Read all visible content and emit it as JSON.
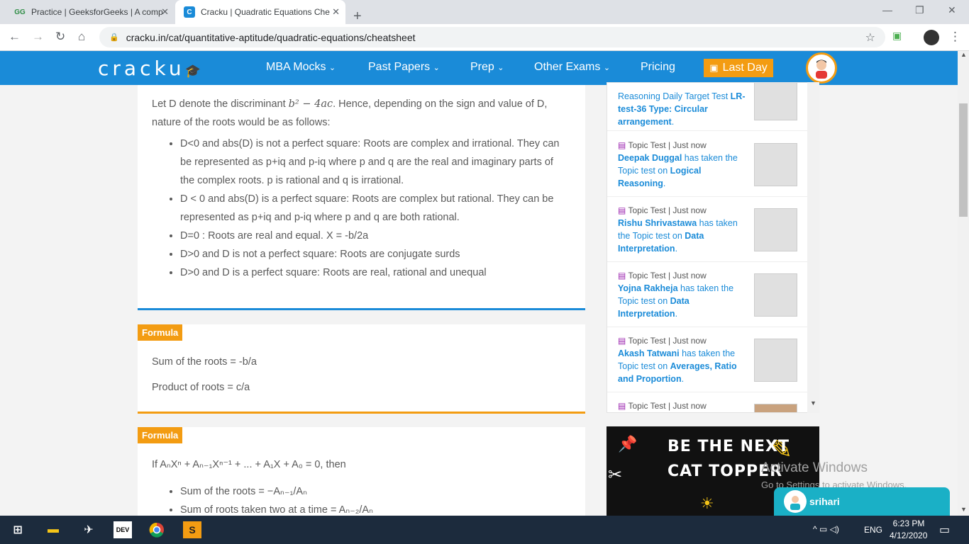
{
  "browser": {
    "tabs": [
      {
        "title": "Practice | GeeksforGeeks | A comp",
        "favicon": "GG"
      },
      {
        "title": "Cracku | Quadratic Equations Che",
        "favicon": "C"
      }
    ],
    "url": "cracku.in/cat/quantitative-aptitude/quadratic-equations/cheatsheet"
  },
  "site": {
    "logo": "cracku",
    "nav": [
      "MBA Mocks",
      "Past Papers",
      "Prep",
      "Other Exams",
      "Pricing"
    ],
    "last_day": "Last Day"
  },
  "content": {
    "intro_pre": "Let D denote the discriminant ",
    "intro_math": "b² − 4ac",
    "intro_post": ". Hence, depending on the sign and value of D, nature of the roots would be as follows:",
    "bullets": [
      "D<0 and abs(D) is not a perfect square: Roots are complex and irrational. They can be represented as p+iq and p-iq where p and q are the real and imaginary parts of the complex roots. p is rational and q is irrational.",
      "D < 0 and abs(D) is a perfect square: Roots are complex but rational. They can be represented as p+iq and p-iq where p and q are both rational.",
      "D=0 : Roots are real and equal. X = -b/2a",
      "D>0 and D is not a perfect square: Roots are conjugate surds",
      "D>0 and D is a perfect square: Roots are real, rational and unequal"
    ],
    "formula_label": "Formula",
    "formula1": [
      "Sum of the roots = -b/a",
      "Product of roots = c/a"
    ],
    "formula2_intro": "If AₙXⁿ + Aₙ₋₁Xⁿ⁻¹ + ... + A₁X + A₀ = 0, then",
    "formula2_items": [
      "Sum of the roots = −Aₙ₋₁/Aₙ",
      "Sum of roots taken two at a time = Aₙ₋₂/Aₙ"
    ]
  },
  "activity": {
    "top_partial": {
      "text_a": "Reasoning Daily Target Test ",
      "bold": "LR-test-36 Type: Circular arrangement",
      "text_b": "."
    },
    "items": [
      {
        "meta": "Topic Test | Just now",
        "name": "Deepak Duggal",
        "mid": " has taken the Topic test on ",
        "topic": "Logical Reasoning"
      },
      {
        "meta": "Topic Test | Just now",
        "name": "Rishu Shrivastawa",
        "mid": " has taken the Topic test on ",
        "topic": "Data Interpretation"
      },
      {
        "meta": "Topic Test | Just now",
        "name": "Yojna Rakheja",
        "mid": " has taken the Topic test on ",
        "topic": "Data Interpretation"
      },
      {
        "meta": "Topic Test | Just now",
        "name": "Akash Tatwani",
        "mid": " has taken the Topic test on ",
        "topic": "Averages, Ratio and Proportion"
      }
    ],
    "bottom_partial": "Topic Test | Just now"
  },
  "banner": {
    "line1": "BE THE NEXT",
    "line2": "CAT TOPPER"
  },
  "overlay": {
    "activate": "Activate Windows",
    "activate_sub": "Go to Settings to activate Windows."
  },
  "chat": {
    "user": "srihari"
  },
  "taskbar": {
    "lang": "ENG",
    "time": "6:23 PM",
    "date": "4/12/2020"
  },
  "colors": {
    "brand": "#1a8bd8",
    "accent": "#f39c12"
  }
}
